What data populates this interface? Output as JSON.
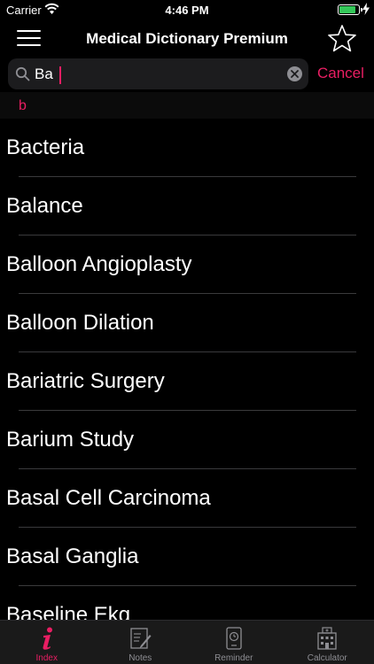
{
  "status": {
    "carrier": "Carrier",
    "time": "4:46 PM",
    "battery_level": 0.85
  },
  "nav": {
    "title": "Medical Dictionary Premium"
  },
  "search": {
    "value": "Ba",
    "placeholder": "",
    "cancel_label": "Cancel"
  },
  "section": {
    "letter": "b"
  },
  "results": [
    "Bacteria",
    "Balance",
    "Balloon Angioplasty",
    "Balloon Dilation",
    "Bariatric Surgery",
    "Barium Study",
    "Basal Cell Carcinoma",
    "Basal Ganglia",
    "Baseline Ekg"
  ],
  "tabs": [
    {
      "label": "Index",
      "icon": "info-icon",
      "active": true
    },
    {
      "label": "Notes",
      "icon": "notes-icon",
      "active": false
    },
    {
      "label": "Reminder",
      "icon": "reminder-icon",
      "active": false
    },
    {
      "label": "Calculator",
      "icon": "calculator-icon",
      "active": false
    }
  ],
  "colors": {
    "accent": "#e91e63",
    "background": "#000000",
    "tab_bar": "#1a1a1a"
  }
}
